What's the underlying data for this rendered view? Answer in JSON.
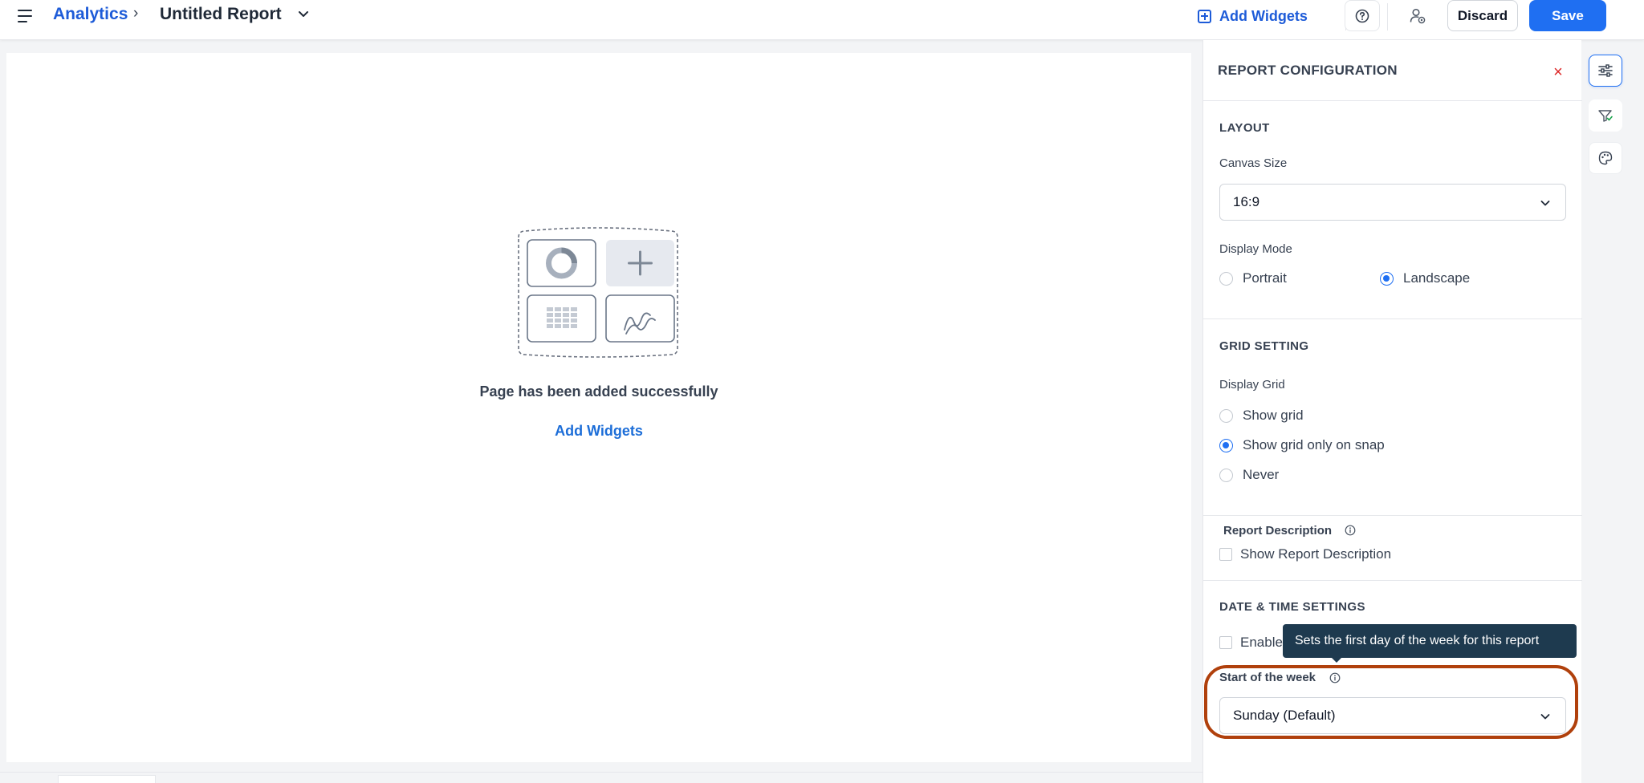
{
  "header": {
    "breadcrumb_app": "Analytics",
    "breadcrumb_separator": "›",
    "report_title": "Untitled Report",
    "add_widgets_label": "Add Widgets",
    "discard_label": "Discard",
    "save_label": "Save"
  },
  "canvas": {
    "empty_message": "Page has been added successfully",
    "add_widgets_link": "Add Widgets"
  },
  "panel": {
    "title": "REPORT CONFIGURATION",
    "close_glyph": "×",
    "layout": {
      "section_title": "LAYOUT",
      "canvas_size_label": "Canvas Size",
      "canvas_size_value": "16:9",
      "display_mode_label": "Display Mode",
      "display_mode_options": [
        "Portrait",
        "Landscape"
      ],
      "display_mode_selected": "Landscape"
    },
    "grid": {
      "section_title": "GRID SETTING",
      "display_grid_label": "Display Grid",
      "options": [
        "Show grid",
        "Show grid only on snap",
        "Never"
      ],
      "selected": "Show grid only on snap"
    },
    "report_description": {
      "label": "Report Description",
      "checkbox_label": "Show Report Description",
      "checked": false
    },
    "date_time": {
      "section_title": "DATE & TIME SETTINGS",
      "enable_checkbox_label": "Enable",
      "enable_checked": false,
      "start_of_week_label": "Start of the week",
      "start_of_week_value": "Sunday (Default)",
      "tooltip": "Sets the first day of the week for this report"
    }
  },
  "colors": {
    "primary": "#1f6ff2",
    "link": "#1d5bd8",
    "close": "#dc2626",
    "tooltip_bg": "#1e3a4f",
    "highlight_ring": "#b0400c"
  },
  "icons": {
    "menu": "hamburger-menu-icon",
    "title_dropdown": "chevron-down-icon",
    "add_widgets": "plus-square-icon",
    "help": "question-circle-icon",
    "share": "user-settings-icon",
    "rail_config": "sliders-icon",
    "rail_filter": "filter-check-icon",
    "rail_theme": "palette-icon",
    "info": "info-circle-icon"
  }
}
